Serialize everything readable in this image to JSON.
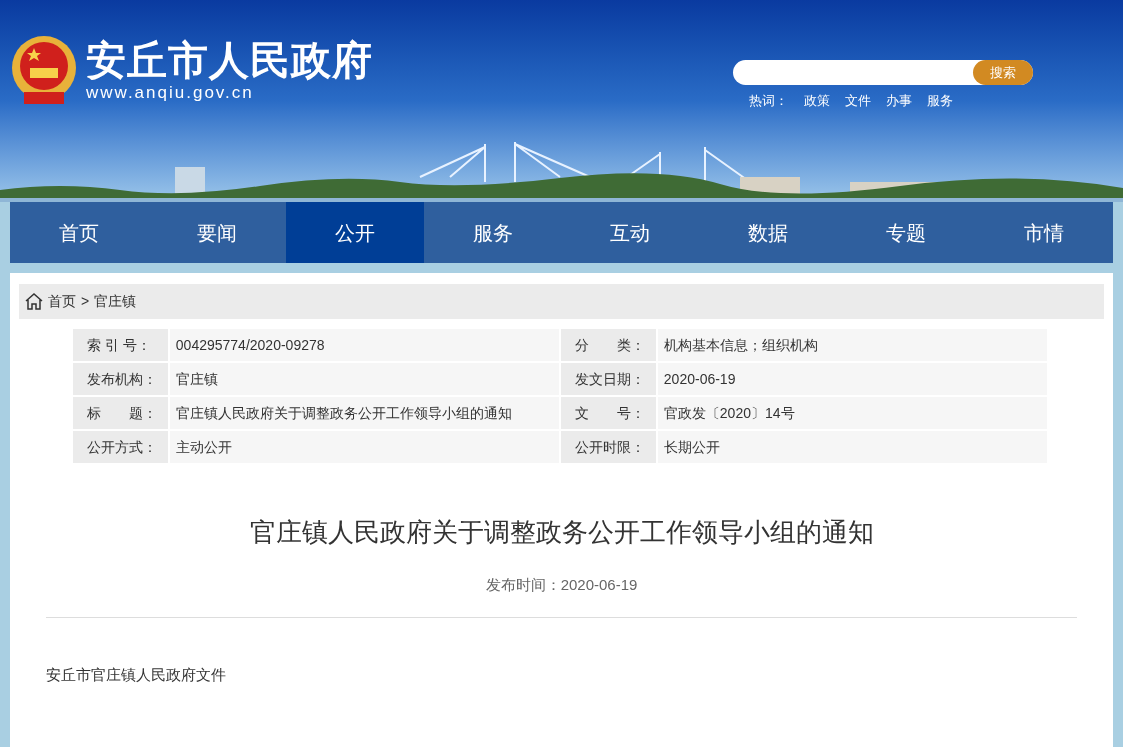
{
  "header": {
    "site_name": "安丘市人民政府",
    "site_url": "www.anqiu.gov.cn",
    "search": {
      "button": "搜索"
    },
    "hot_words": {
      "label": "热词：",
      "words": [
        "政策",
        "文件",
        "办事",
        "服务"
      ]
    }
  },
  "nav": [
    {
      "label": "首页",
      "selected": false
    },
    {
      "label": "要闻",
      "selected": false
    },
    {
      "label": "公开",
      "selected": true
    },
    {
      "label": "服务",
      "selected": false
    },
    {
      "label": "互动",
      "selected": false
    },
    {
      "label": "数据",
      "selected": false
    },
    {
      "label": "专题",
      "selected": false
    },
    {
      "label": "市情",
      "selected": false
    }
  ],
  "breadcrumb": {
    "items": [
      "首页",
      "官庄镇"
    ],
    "separator": ">"
  },
  "info_table": [
    [
      {
        "label": "索 引 号：",
        "value": "004295774/2020-09278"
      },
      {
        "label": "分　　类：",
        "value": "机构基本信息；组织机构"
      }
    ],
    [
      {
        "label": "发布机构：",
        "value": "官庄镇"
      },
      {
        "label": "发文日期：",
        "value": "2020-06-19"
      }
    ],
    [
      {
        "label": "标　　题：",
        "value": "官庄镇人民政府关于调整政务公开工作领导小组的通知"
      },
      {
        "label": "文　　号：",
        "value": "官政发〔2020〕14号"
      }
    ],
    [
      {
        "label": "公开方式：",
        "value": "主动公开"
      },
      {
        "label": "公开时限：",
        "value": "长期公开"
      }
    ]
  ],
  "article": {
    "title": "官庄镇人民政府关于调整政务公开工作领导小组的通知",
    "publish_time": "发布时间：2020-06-19",
    "body": [
      "安丘市官庄镇人民政府文件"
    ]
  }
}
